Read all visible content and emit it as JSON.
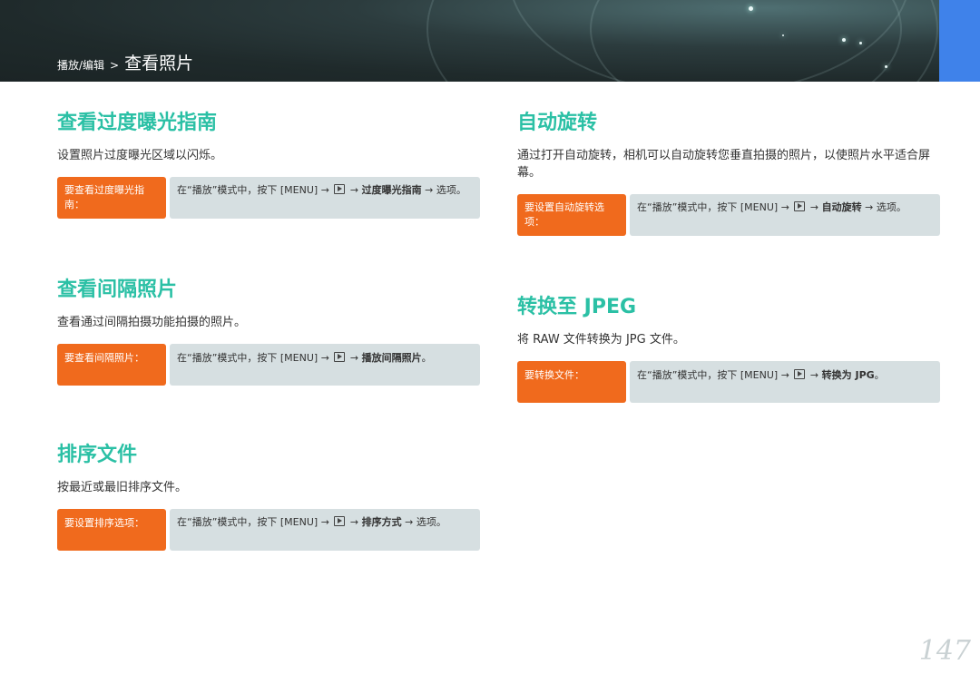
{
  "header": {
    "crumb_section": "播放/编辑",
    "crumb_sep": ">",
    "crumb_title": "查看照片"
  },
  "colors": {
    "accent_heading": "#2bc0a5",
    "tag_bg": "#f06a1d",
    "steps_bg": "#d6dfe1",
    "header_accent": "#3f82ea"
  },
  "icons": {
    "playback": "playback-mode-icon"
  },
  "sections": {
    "overexposure": {
      "title": "查看过度曝光指南",
      "desc": "设置照片过度曝光区域以闪烁。",
      "tag": "要查看过度曝光指南：",
      "step_prefix": "在“播放”模式中，按下 [MENU] →",
      "step_arrow": "→",
      "step_item": "过度曝光指南",
      "step_suffix": "→ 选项。"
    },
    "interval": {
      "title": "查看间隔照片",
      "desc": "查看通过间隔拍摄功能拍摄的照片。",
      "tag": "要查看间隔照片：",
      "step_prefix": "在“播放”模式中，按下 [MENU] →",
      "step_arrow": "→",
      "step_item": "播放间隔照片",
      "step_suffix": "。"
    },
    "sort": {
      "title": "排序文件",
      "desc": "按最近或最旧排序文件。",
      "tag": "要设置排序选项：",
      "step_prefix": "在“播放”模式中，按下 [MENU] →",
      "step_arrow": "→",
      "step_item": "排序方式",
      "step_suffix": "→ 选项。"
    },
    "autorotate": {
      "title": "自动旋转",
      "desc": "通过打开自动旋转，相机可以自动旋转您垂直拍摄的照片，以使照片水平适合屏幕。",
      "tag": "要设置自动旋转选项：",
      "step_prefix": "在“播放”模式中，按下 [MENU] →",
      "step_arrow": "→",
      "step_item": "自动旋转",
      "step_suffix": "→ 选项。"
    },
    "jpeg": {
      "title": "转换至 JPEG",
      "desc": "将 RAW 文件转换为 JPG 文件。",
      "tag": "要转换文件：",
      "step_prefix": "在“播放”模式中，按下 [MENU] →",
      "step_arrow": "→",
      "step_item": "转换为 JPG",
      "step_suffix": "。"
    }
  },
  "page_number": "147"
}
